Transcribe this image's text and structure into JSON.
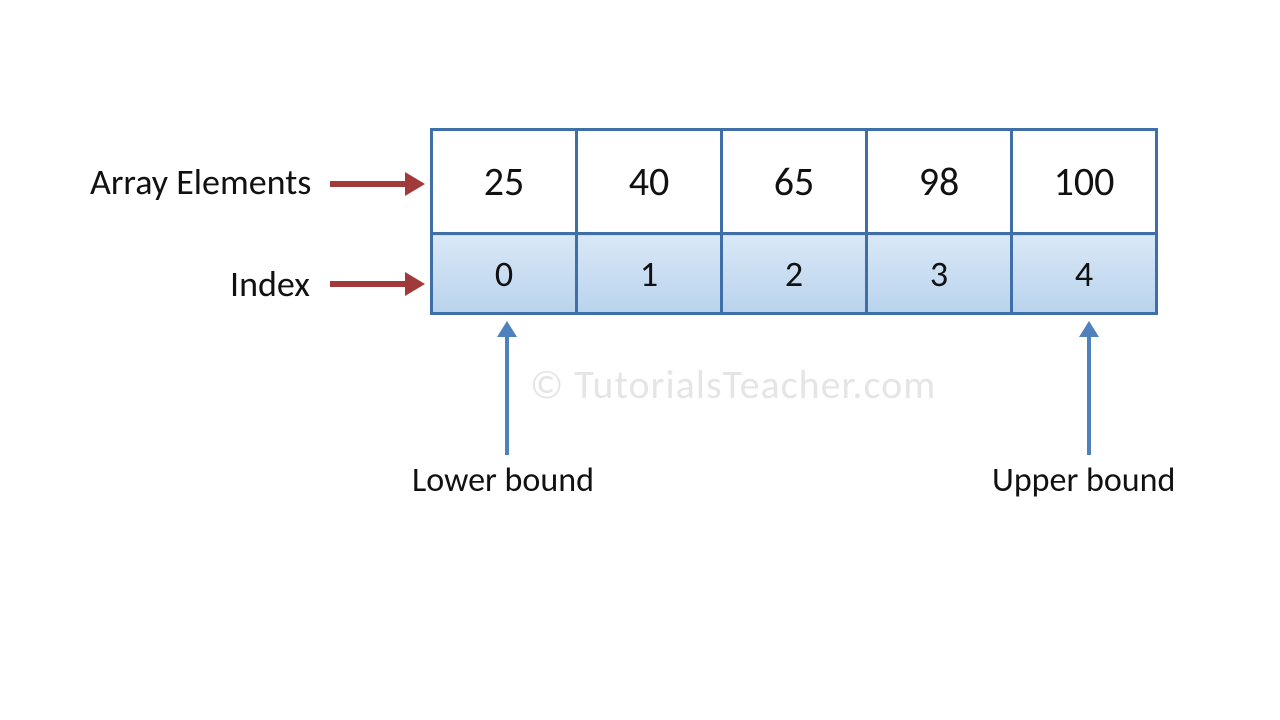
{
  "labels": {
    "elements": "Array Elements",
    "index": "Index",
    "lower_bound": "Lower bound",
    "upper_bound": "Upper bound"
  },
  "array": {
    "values": [
      "25",
      "40",
      "65",
      "98",
      "100"
    ],
    "indices": [
      "0",
      "1",
      "2",
      "3",
      "4"
    ]
  },
  "watermark": "© TutorialsTeacher.com",
  "colors": {
    "border": "#3e6fa9",
    "index_fill_top": "#d9e8f7",
    "index_fill_bottom": "#b9d3ed",
    "red_arrow": "#a13b3b",
    "blue_arrow": "#4f81bd"
  }
}
